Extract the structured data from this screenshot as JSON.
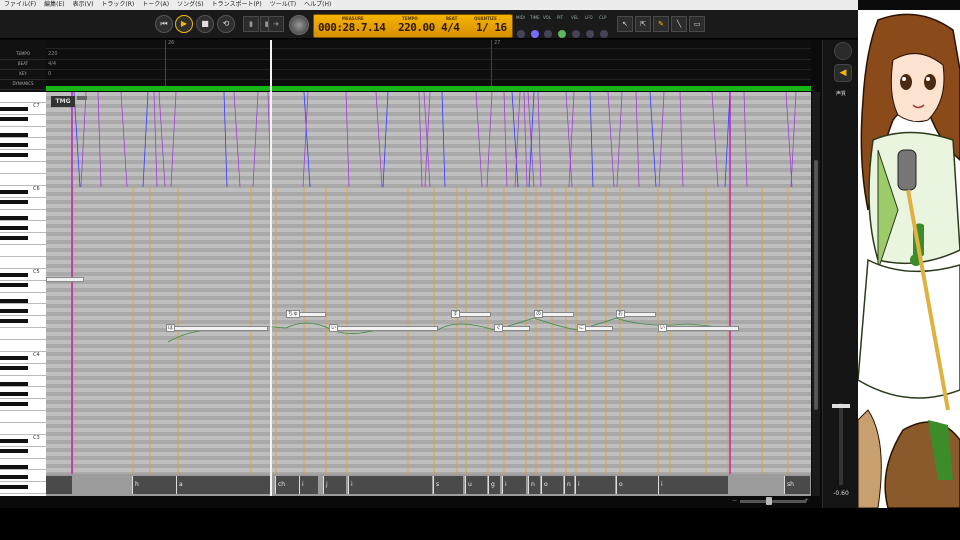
{
  "menu": [
    "ファイル(F)",
    "編集(E)",
    "表示(V)",
    "トラック(R)",
    "トーク(A)",
    "ソング(S)",
    "トランスポート(P)",
    "ツール(T)",
    "ヘルプ(H)"
  ],
  "transport": {
    "measure_label": "MEASURE",
    "measure_value": "000:28.7.14",
    "tempo_label": "TEMPO",
    "tempo_value": "220.00",
    "beat_label": "BEAT",
    "beat_value": "4/4",
    "quantize_label": "QUANTIZE",
    "quantize_value": "1/ 16"
  },
  "toolbar_mini": [
    "MIDI",
    "TIME",
    "VOL",
    "PIT",
    "VEL",
    "LFO",
    "CLP"
  ],
  "left_labels": [
    "TEMPO",
    "BEAT",
    "KEY",
    "DYNAMICS"
  ],
  "ruler": {
    "tempo_value": "220",
    "beat_value": "4/4",
    "key_value": "0",
    "measure_26": "26",
    "measure_27": "27"
  },
  "track_badge": "TMG",
  "octaves": [
    "C7",
    "C6",
    "C5",
    "C4",
    "C3"
  ],
  "notes": [
    {
      "lyric": "は"
    },
    {
      "lyric": "ちゅ"
    },
    {
      "lyric": "い"
    },
    {
      "lyric": "す"
    },
    {
      "lyric": "ぐ"
    },
    {
      "lyric": "の"
    },
    {
      "lyric": "に"
    },
    {
      "lyric": "お"
    },
    {
      "lyric": "い"
    }
  ],
  "phonemes": [
    "h",
    "a",
    "ch",
    "i",
    "j",
    "i",
    "s",
    "u",
    "g",
    "i",
    "n",
    "o",
    "n",
    "i",
    "o",
    "i",
    "sh"
  ],
  "track_panel": {
    "channel_label": "声質",
    "volume": "-0.60"
  },
  "colors": {
    "lcd": "#f5b400",
    "dynamics_bar": "#17b617",
    "grid_light": "#bfbfbf",
    "grid_dark": "#a9a9a9",
    "purple_lines": "#a040d0",
    "orange_lines": "#e8a020"
  },
  "icons": [
    "rewind-icon",
    "play-icon",
    "stop-icon",
    "loop-icon",
    "select-arrow-icon",
    "pencil-icon",
    "eraser-icon",
    "speaker-icon"
  ]
}
